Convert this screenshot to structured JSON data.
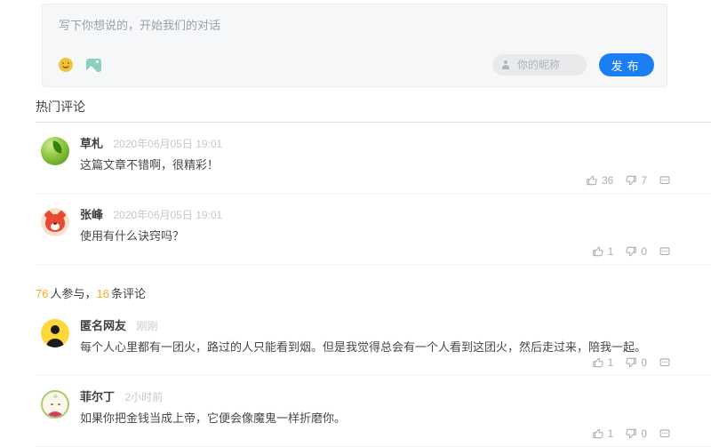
{
  "composer": {
    "placeholder": "写下你想说的，开始我们的对话",
    "nickname": {
      "placeholder": "你的昵称",
      "value": ""
    },
    "publish_button": "发布",
    "icons": {
      "emoji": "emoji-smiley-icon",
      "image": "image-upload-icon",
      "user": "user-icon"
    }
  },
  "hot_comments": {
    "title": "热门评论"
  },
  "stats": {
    "participants_count": "76",
    "participants_label": "人参与，",
    "comments_count": "16",
    "comments_label": "条评论"
  },
  "colors": {
    "accent_blue": "#1b7ef2",
    "stats_orange": "#ffa826",
    "composer_bg": "#f6f7f8"
  },
  "comments": [
    {
      "section": "hot",
      "name": "草札",
      "time": "2020年06月05日 19:01",
      "text": "这篇文章不错啊，很精彩！",
      "likes": "36",
      "dislikes": "7",
      "avatar_icon": "green-orb-avatar",
      "avatar_style": "green"
    },
    {
      "section": "hot",
      "name": "张峰",
      "time": "2020年06月05日 19:01",
      "text": "使用有什么诀窍吗？",
      "likes": "1",
      "dislikes": "0",
      "avatar_icon": "red-fox-avatar",
      "avatar_style": "fox"
    },
    {
      "section": "latest",
      "name": "匿名网友",
      "time": "刚刚",
      "text": "每个人心里都有一团火，路过的人只能看到烟。但是我觉得总会有一个人看到这团火，然后走过来，陪我一起。",
      "likes": "1",
      "dislikes": "0",
      "avatar_icon": "anonymous-user-avatar",
      "avatar_style": "anon"
    },
    {
      "section": "latest",
      "name": "菲尔丁",
      "time": "2小时前",
      "text": "如果你把金钱当成上帝，它便会像魔鬼一样折磨你。",
      "likes": "1",
      "dislikes": "0",
      "avatar_icon": "lamb-avatar",
      "avatar_style": "lamb"
    }
  ]
}
